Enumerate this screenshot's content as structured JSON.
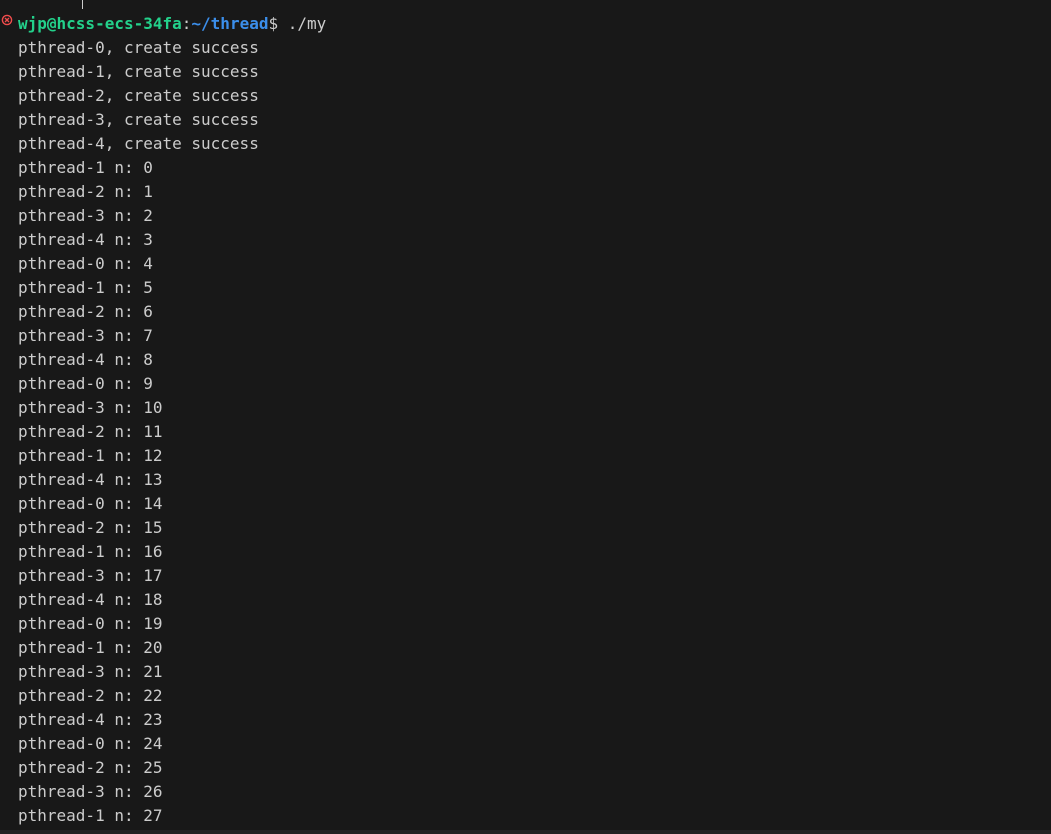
{
  "theme": {
    "background": "#181818",
    "foreground": "#cccccc",
    "user_host_color": "#23d18b",
    "path_color": "#3b8eea",
    "error_icon_color": "#f14c4c"
  },
  "prompt": {
    "status_icon": "error-circle-x-icon",
    "user_host": "wjp@hcss-ecs-34fa",
    "separator": ":",
    "path": "~/thread",
    "dollar": "$",
    "command": " ./my"
  },
  "output_lines": [
    "pthread-0, create success",
    "pthread-1, create success",
    "pthread-2, create success",
    "pthread-3, create success",
    "pthread-4, create success",
    "pthread-1 n: 0",
    "pthread-2 n: 1",
    "pthread-3 n: 2",
    "pthread-4 n: 3",
    "pthread-0 n: 4",
    "pthread-1 n: 5",
    "pthread-2 n: 6",
    "pthread-3 n: 7",
    "pthread-4 n: 8",
    "pthread-0 n: 9",
    "pthread-3 n: 10",
    "pthread-2 n: 11",
    "pthread-1 n: 12",
    "pthread-4 n: 13",
    "pthread-0 n: 14",
    "pthread-2 n: 15",
    "pthread-1 n: 16",
    "pthread-3 n: 17",
    "pthread-4 n: 18",
    "pthread-0 n: 19",
    "pthread-1 n: 20",
    "pthread-3 n: 21",
    "pthread-2 n: 22",
    "pthread-4 n: 23",
    "pthread-0 n: 24",
    "pthread-2 n: 25",
    "pthread-3 n: 26",
    "pthread-1 n: 27"
  ]
}
